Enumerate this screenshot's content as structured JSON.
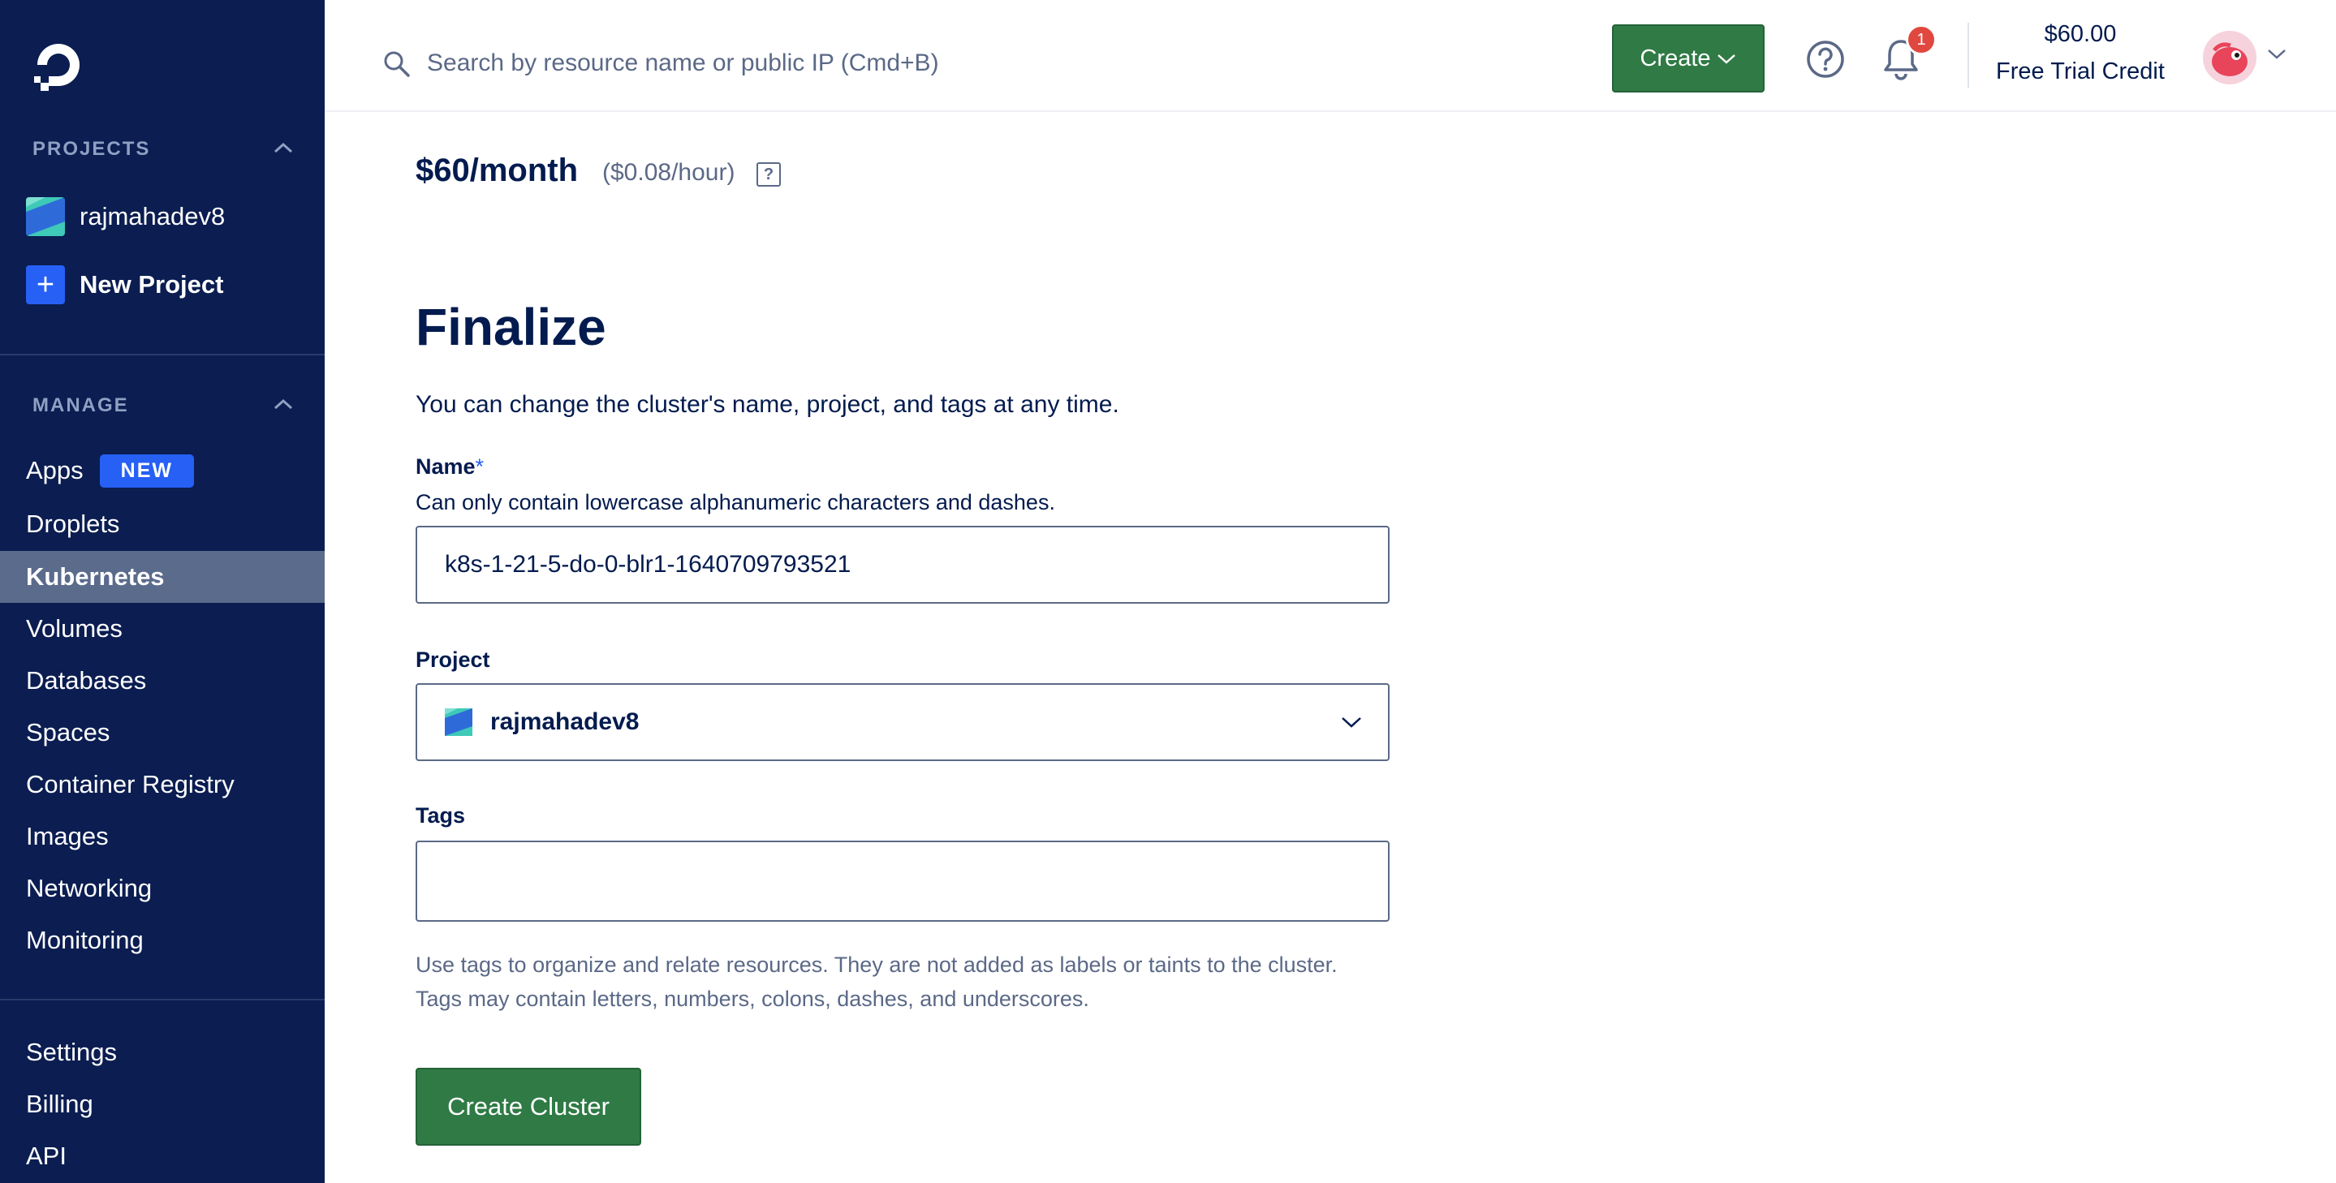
{
  "sidebar": {
    "projects_heading": "PROJECTS",
    "projects": [
      {
        "label": "rajmahadev8"
      }
    ],
    "new_project_label": "New Project",
    "manage_heading": "MANAGE",
    "manage_items": [
      {
        "label": "Apps",
        "badge": "NEW"
      },
      {
        "label": "Droplets"
      },
      {
        "label": "Kubernetes",
        "active": true
      },
      {
        "label": "Volumes"
      },
      {
        "label": "Databases"
      },
      {
        "label": "Spaces"
      },
      {
        "label": "Container Registry"
      },
      {
        "label": "Images"
      },
      {
        "label": "Networking"
      },
      {
        "label": "Monitoring"
      }
    ],
    "footer_items": [
      {
        "label": "Settings"
      },
      {
        "label": "Billing"
      },
      {
        "label": "API"
      }
    ]
  },
  "header": {
    "search_placeholder": "Search by resource name or public IP (Cmd+B)",
    "create_label": "Create",
    "notification_count": "1",
    "credit_amount": "$60.00",
    "credit_label": "Free Trial Credit"
  },
  "main": {
    "price_monthly": "$60/month",
    "price_hourly": "($0.08/hour)",
    "price_help": "?",
    "finalize_title": "Finalize",
    "finalize_subtitle": "You can change the cluster's name, project, and tags at any time.",
    "name_label": "Name",
    "name_required_mark": "*",
    "name_hint": "Can only contain lowercase alphanumeric characters and dashes.",
    "name_value": "k8s-1-21-5-do-0-blr1-1640709793521",
    "project_label": "Project",
    "project_value": "rajmahadev8",
    "tags_label": "Tags",
    "tags_value": "",
    "tags_hint_line1": "Use tags to organize and relate resources. They are not added as labels or taints to the cluster.",
    "tags_hint_line2": "Tags may contain letters, numbers, colons, dashes, and underscores.",
    "create_cluster_label": "Create Cluster"
  },
  "colors": {
    "sidebar_bg": "#0b1d51",
    "active_nav_bg": "#5b6b8c",
    "primary_green": "#2f7a45",
    "accent_blue": "#2660f5",
    "badge_red": "#e0483f",
    "text_dark": "#031b4e"
  },
  "icons": [
    "logo-icon",
    "chevron-up-icon",
    "search-icon",
    "chevron-down-icon",
    "help-circle-icon",
    "bell-icon",
    "avatar",
    "plus-icon",
    "project-swatch-icon"
  ]
}
